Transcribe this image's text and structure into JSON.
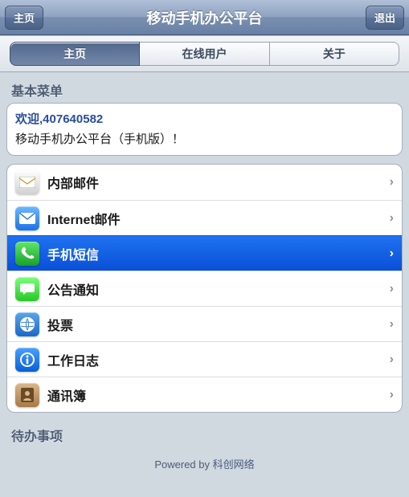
{
  "nav": {
    "left": "主页",
    "title": "移动手机办公平台",
    "right": "退出"
  },
  "tabs": [
    {
      "label": "主页",
      "active": true
    },
    {
      "label": "在线用户",
      "active": false
    },
    {
      "label": "关于",
      "active": false
    }
  ],
  "sections": {
    "basic_menu": "基本菜单",
    "todo": "待办事项"
  },
  "welcome": {
    "greeting": "欢迎,407640582",
    "subtitle": "移动手机办公平台（手机版）！"
  },
  "menu": [
    {
      "label": "内部邮件",
      "icon": "mail"
    },
    {
      "label": "Internet邮件",
      "icon": "internet"
    },
    {
      "label": "手机短信",
      "icon": "sms",
      "selected": true
    },
    {
      "label": "公告通知",
      "icon": "notice"
    },
    {
      "label": "投票",
      "icon": "vote"
    },
    {
      "label": "工作日志",
      "icon": "log"
    },
    {
      "label": "通讯簿",
      "icon": "contacts"
    }
  ],
  "footer": {
    "powered": "Powered by",
    "credit": "科创网络"
  }
}
